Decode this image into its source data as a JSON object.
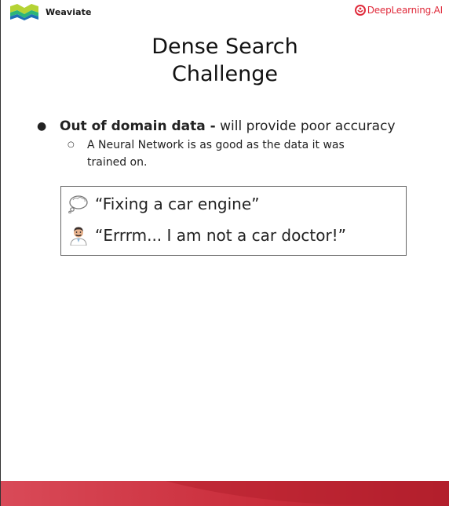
{
  "header": {
    "left_brand": "Weaviate",
    "right_brand": "DeepLearning.AI",
    "brand_color": "#e02c3c"
  },
  "title": {
    "line1": "Dense Search",
    "line2": "Challenge"
  },
  "bullets": {
    "main_bold": "Out of domain data -",
    "main_rest": " will provide poor accuracy",
    "sub_line1": "A Neural Network is as good as the data it was",
    "sub_line2": "trained on."
  },
  "quotes": [
    {
      "icon": "thought-bubble-icon",
      "text": "“Fixing a car engine”"
    },
    {
      "icon": "doctor-icon",
      "text": "“Errrm... I am not a car doctor!”"
    }
  ],
  "footer": {
    "colors": [
      "#d6434f",
      "#b7202e"
    ]
  }
}
